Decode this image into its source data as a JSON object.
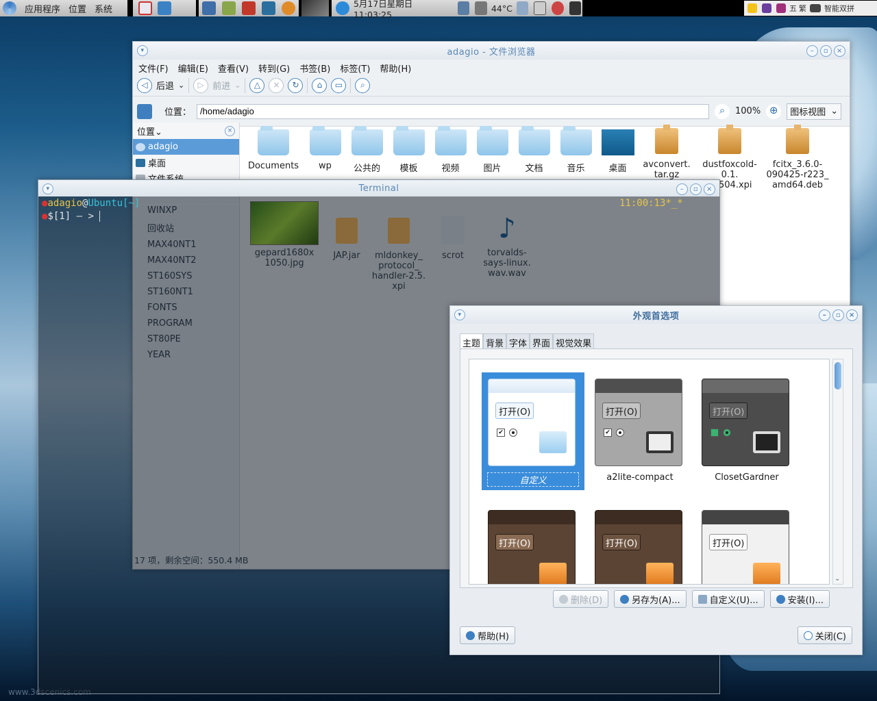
{
  "panel": {
    "menus": [
      "应用程序",
      "位置",
      "系统"
    ],
    "clock": "5月17日星期日 11:03:25",
    "temp": "44°C",
    "im": [
      "五",
      "繁",
      "智能双拼"
    ]
  },
  "fb": {
    "title": "adagio - 文件浏览器",
    "menu": [
      "文件(F)",
      "编辑(E)",
      "查看(V)",
      "转到(G)",
      "书签(B)",
      "标签(T)",
      "帮助(H)"
    ],
    "back": "后退",
    "forward": "前进",
    "location_label": "位置：",
    "location": "/home/adagio",
    "zoom": "100%",
    "view": "图标视图",
    "sidebar_title": "位置",
    "sidebar": [
      "adagio",
      "桌面",
      "文件系统"
    ],
    "sidebar2": [
      "WINXP",
      "回收站"
    ],
    "drives": [
      "MAX40NT1",
      "MAX40NT2",
      "ST160SYS",
      "ST160NT1",
      "FONTS",
      "PROGRAM",
      "ST80PE",
      "YEAR"
    ],
    "files": [
      "Documents",
      "wp",
      "公共的",
      "模板",
      "视频",
      "图片",
      "文档",
      "音乐",
      "桌面"
    ],
    "pkgs": [
      "avconvert.\ntar.gz",
      "dustfoxcold-\n0.1.\n90504.xpi",
      "fcitx_3.6.0-\n090425-r223_\namd64.deb"
    ],
    "dimfiles": [
      "gepard1680x\n1050.jpg",
      "JAP.jar",
      "mldonkey_\nprotocol_\nhandler-2.5.\nxpi",
      "scrot",
      "torvalds-\nsays-linux.\nwav.wav"
    ],
    "status": "17 项，剩余空间：550.4 MB"
  },
  "term": {
    "title": "Terminal",
    "user": "adagio",
    "at": "@",
    "host": "Ubuntu",
    "path": "[~]",
    "prompt": "$[1] — > ",
    "time": "11:00:13*_*"
  },
  "ap": {
    "title": "外观首选项",
    "tabs": [
      "主题",
      "背景",
      "字体",
      "界面",
      "视觉效果"
    ],
    "themes": [
      "自定义",
      "a2lite-compact",
      "ClosetGardner"
    ],
    "open": "打开(O)",
    "buttons": [
      "删除(D)",
      "另存为(A)...",
      "自定义(U)...",
      "安装(I)..."
    ],
    "help": "帮助(H)",
    "close": "关闭(C)"
  },
  "watermark": "www.3dscenics.com",
  "colors": {
    "accent": "#3a8ddb",
    "title": "#5a87b5",
    "prompt_user": "#e8c547",
    "prompt_host": "#39c2d8"
  }
}
